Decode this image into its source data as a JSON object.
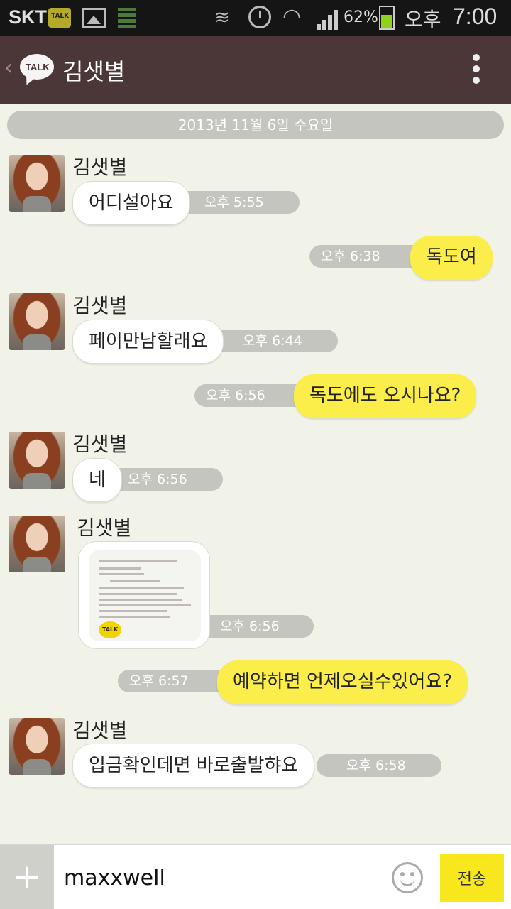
{
  "status_bar": {
    "carrier": "SKT",
    "battery": "62%",
    "ampm": "오후",
    "time": "7:00"
  },
  "header": {
    "title": "김샛별",
    "talk_badge": "TALK"
  },
  "date_divider": "2013년 11월 6일 수요일",
  "messages": [
    {
      "direction": "in",
      "sender": "김샛별",
      "text": "어디설아요",
      "time": "오후 5:55"
    },
    {
      "direction": "out",
      "text": "독도여",
      "time": "오후 6:38"
    },
    {
      "direction": "in",
      "sender": "김샛별",
      "text": "페이만남할래요",
      "time": "오후 6:44"
    },
    {
      "direction": "out",
      "text": "독도에도 오시나요?",
      "time": "오후 6:56"
    },
    {
      "direction": "in",
      "sender": "김샛별",
      "text": "네",
      "time": "오후 6:56"
    },
    {
      "direction": "in",
      "sender": "김샛별",
      "type": "image",
      "time": "오후 6:56"
    },
    {
      "direction": "out",
      "text": "예약하면 언제오실수있어요?",
      "time": "오후 6:57"
    },
    {
      "direction": "in",
      "sender": "김샛별",
      "text": "입금확인데면 바로출발햐요",
      "time": "오후 6:58"
    }
  ],
  "input": {
    "value": "maxxwell",
    "send_label": "전송"
  },
  "colors": {
    "header": "#4c3738",
    "outgoing_bubble": "#fbed4a",
    "background": "#f1f3e8",
    "timestamp_pill": "#c4c5bf"
  }
}
